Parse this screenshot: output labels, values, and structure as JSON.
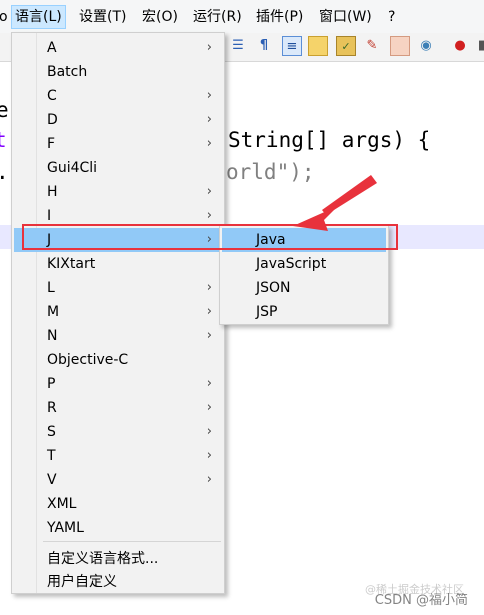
{
  "menubar": {
    "items": [
      {
        "label": "o"
      },
      {
        "label": "语言(L)"
      },
      {
        "label": "设置(T)"
      },
      {
        "label": "宏(O)"
      },
      {
        "label": "运行(R)"
      },
      {
        "label": "插件(P)"
      },
      {
        "label": "窗口(W)"
      },
      {
        "label": "?"
      }
    ]
  },
  "editor": {
    "line1": "e",
    "line2_prefix": "t",
    "line2_code": "String[] args) {",
    "line3_prefix": ".",
    "line3_code": "orld\");"
  },
  "language_menu": {
    "items": [
      {
        "label": "A",
        "submenu": true
      },
      {
        "label": "Batch",
        "submenu": false
      },
      {
        "label": "C",
        "submenu": true
      },
      {
        "label": "D",
        "submenu": true
      },
      {
        "label": "F",
        "submenu": true
      },
      {
        "label": "Gui4Cli",
        "submenu": false
      },
      {
        "label": "H",
        "submenu": true
      },
      {
        "label": "I",
        "submenu": true
      },
      {
        "label": "J",
        "submenu": true
      },
      {
        "label": "KIXtart",
        "submenu": false
      },
      {
        "label": "L",
        "submenu": true
      },
      {
        "label": "M",
        "submenu": true
      },
      {
        "label": "N",
        "submenu": true
      },
      {
        "label": "Objective-C",
        "submenu": false
      },
      {
        "label": "P",
        "submenu": true
      },
      {
        "label": "R",
        "submenu": true
      },
      {
        "label": "S",
        "submenu": true
      },
      {
        "label": "T",
        "submenu": true
      },
      {
        "label": "V",
        "submenu": true
      },
      {
        "label": "XML",
        "submenu": false
      },
      {
        "label": "YAML",
        "submenu": false
      }
    ],
    "custom_format": "自定义语言格式...",
    "user_defined": "用户自定义",
    "chevron": "›"
  },
  "j_submenu": {
    "items": [
      {
        "label": "Java"
      },
      {
        "label": "JavaScript"
      },
      {
        "label": "JSON"
      },
      {
        "label": "JSP"
      }
    ]
  },
  "watermark": {
    "text": "CSDN @福小简",
    "faint_text": "@稀土掘金技术社区"
  },
  "colors": {
    "hover": "#91c9f7",
    "menu_bg": "#f2f2f2",
    "annotation_red": "#e8323c"
  }
}
